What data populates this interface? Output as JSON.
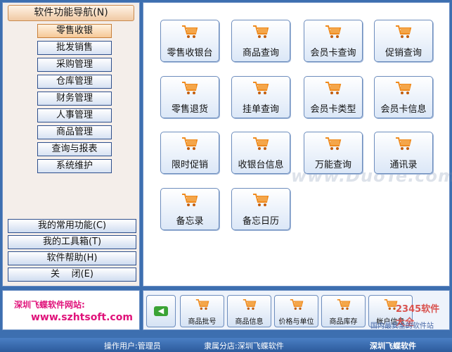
{
  "sidebar": {
    "header": "软件功能导航(N)",
    "items": [
      {
        "label": "零售收银",
        "selected": true
      },
      {
        "label": "批发销售",
        "selected": false
      },
      {
        "label": "采购管理",
        "selected": false
      },
      {
        "label": "仓库管理",
        "selected": false
      },
      {
        "label": "财务管理",
        "selected": false
      },
      {
        "label": "人事管理",
        "selected": false
      },
      {
        "label": "商品管理",
        "selected": false
      },
      {
        "label": "查询与报表",
        "selected": false
      },
      {
        "label": "系统维护",
        "selected": false
      }
    ],
    "lower_items": [
      {
        "label": "我的常用功能(C)"
      },
      {
        "label": "我的工具箱(T)"
      },
      {
        "label": "软件帮助(H)"
      },
      {
        "label": "关    闭(E)"
      }
    ]
  },
  "main": {
    "tiles": [
      {
        "label": "零售收银台",
        "icon": "cart-icon"
      },
      {
        "label": "商品查询",
        "icon": "cart-icon"
      },
      {
        "label": "会员卡查询",
        "icon": "cart-icon"
      },
      {
        "label": "促销查询",
        "icon": "cart-icon"
      },
      {
        "label": "零售退货",
        "icon": "cart-icon"
      },
      {
        "label": "挂单查询",
        "icon": "cart-icon"
      },
      {
        "label": "会员卡类型",
        "icon": "cart-icon"
      },
      {
        "label": "会员卡信息",
        "icon": "cart-icon"
      },
      {
        "label": "限时促销",
        "icon": "cart-icon"
      },
      {
        "label": "收银台信息",
        "icon": "cart-icon"
      },
      {
        "label": "万能查询",
        "icon": "cart-icon"
      },
      {
        "label": "通讯录",
        "icon": "cart-icon"
      },
      {
        "label": "备忘录",
        "icon": "cart-icon"
      },
      {
        "label": "备忘日历",
        "icon": "cart-icon"
      }
    ],
    "watermark": "www.DuoTe.com"
  },
  "website": {
    "label": "深圳飞蝶软件网站:",
    "url": "www.szhtsoft.com"
  },
  "toolbar": {
    "back_icon": "left-arrow-icon",
    "items": [
      {
        "label": "商品批号"
      },
      {
        "label": "商品信息"
      },
      {
        "label": "价格与单位"
      },
      {
        "label": "商品库存"
      },
      {
        "label": "帐户信息"
      }
    ]
  },
  "corner_logo": {
    "text": "2345软件大全",
    "subtext": "国内最安全的软件站"
  },
  "status": {
    "operator": "操作用户:管理员",
    "store": "隶属分店:深圳飞蝶软件",
    "company": "深圳飞蝶软件"
  },
  "colors": {
    "accent_blue": "#3d6fb0",
    "cart_orange": "#f08a1c",
    "website_pink": "#e0127a"
  }
}
